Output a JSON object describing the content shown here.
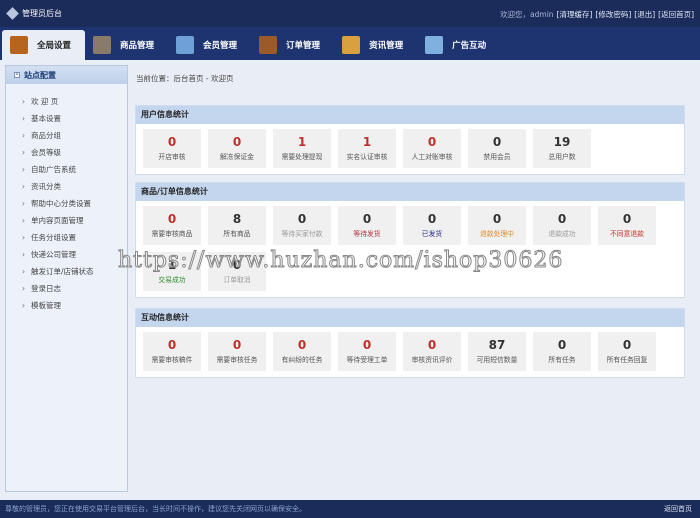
{
  "header": {
    "title": "管理员后台",
    "welcome": "欢迎您，admin",
    "links": [
      "[清理缓存]",
      "[修改密码]",
      "[退出]",
      "[返回首页]"
    ]
  },
  "nav": [
    {
      "label": "全局设置",
      "color": "#b5651d"
    },
    {
      "label": "商品管理",
      "color": "#8a7a6a"
    },
    {
      "label": "会员管理",
      "color": "#6fa0d8"
    },
    {
      "label": "订单管理",
      "color": "#9a5a2a"
    },
    {
      "label": "资讯管理",
      "color": "#d9a040"
    },
    {
      "label": "广告互动",
      "color": "#7fb0e0"
    }
  ],
  "sidebar": {
    "title": "站点配置",
    "items": [
      "欢 迎 页",
      "基本设置",
      "商品分组",
      "会员等级",
      "自助广告系统",
      "资讯分类",
      "帮助中心分类设置",
      "单内容页面管理",
      "任务分组设置",
      "快递公司管理",
      "触发订单/店铺状态",
      "登录日志",
      "模板管理"
    ]
  },
  "breadcrumb": "当前位置：后台首页 - 欢迎页",
  "sections": [
    {
      "title": "用户信息统计",
      "items": [
        {
          "value": "0",
          "label": "开店审核",
          "color": "#c0302a"
        },
        {
          "value": "0",
          "label": "解冻保证金",
          "color": "#c0302a"
        },
        {
          "value": "1",
          "label": "需要处理提现",
          "color": "#c0302a"
        },
        {
          "value": "1",
          "label": "实名认证审核",
          "color": "#c0302a"
        },
        {
          "value": "0",
          "label": "人工对账审核",
          "color": "#c0302a"
        },
        {
          "value": "0",
          "label": "禁用会员",
          "color": "#333333"
        },
        {
          "value": "19",
          "label": "总用户数",
          "color": "#333333"
        }
      ]
    },
    {
      "title": "商品/订单信息统计",
      "items": [
        {
          "value": "0",
          "label": "需要审核商品",
          "color": "#c0302a"
        },
        {
          "value": "8",
          "label": "所有商品",
          "color": "#333333"
        },
        {
          "value": "0",
          "label": "等待买家付款",
          "color": "#333333",
          "lcolor": "#999999"
        },
        {
          "value": "0",
          "label": "等待发货",
          "color": "#333333",
          "lcolor": "#b03040"
        },
        {
          "value": "0",
          "label": "已发货",
          "color": "#333333",
          "lcolor": "#2a2a8a"
        },
        {
          "value": "0",
          "label": "退款处理中",
          "color": "#333333",
          "lcolor": "#e08a30"
        },
        {
          "value": "0",
          "label": "退款成功",
          "color": "#333333",
          "lcolor": "#999999"
        },
        {
          "value": "0",
          "label": "不同意退款",
          "color": "#333333",
          "lcolor": "#c0302a"
        },
        {
          "value": "1",
          "label": "交易成功",
          "color": "#333333",
          "lcolor": "#2e8b2e"
        },
        {
          "value": "0",
          "label": "订单取消",
          "color": "#333333",
          "lcolor": "#999999"
        }
      ]
    },
    {
      "title": "互动信息统计",
      "items": [
        {
          "value": "0",
          "label": "需要审核稿件",
          "color": "#c0302a"
        },
        {
          "value": "0",
          "label": "需要审核任务",
          "color": "#c0302a"
        },
        {
          "value": "0",
          "label": "有纠纷的任务",
          "color": "#c0302a"
        },
        {
          "value": "0",
          "label": "等待受理工单",
          "color": "#c0302a"
        },
        {
          "value": "0",
          "label": "审核资讯评价",
          "color": "#c0302a"
        },
        {
          "value": "87",
          "label": "可用短信数量",
          "color": "#333333"
        },
        {
          "value": "0",
          "label": "所有任务",
          "color": "#333333"
        },
        {
          "value": "0",
          "label": "所有任务回复",
          "color": "#333333"
        }
      ]
    }
  ],
  "watermark": "https://www.huzhan.com/ishop30626",
  "footer": {
    "notice": "尊敬的管理员，您正在使用交易平台管理后台，当长时间不操作，建议您先关闭网页以确保安全。",
    "home": "返回首页"
  }
}
